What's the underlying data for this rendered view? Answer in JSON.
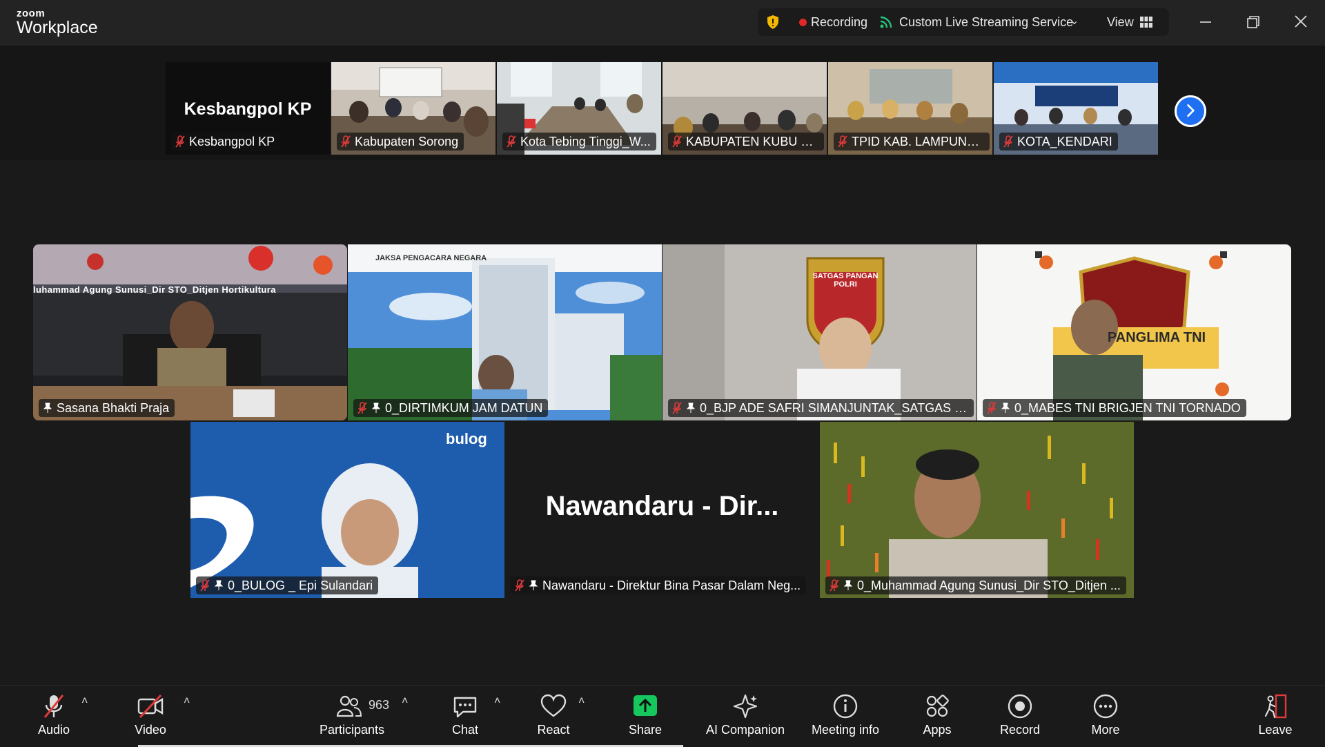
{
  "app": {
    "brand_small": "zoom",
    "brand_big": "Workplace"
  },
  "status_bar": {
    "recording_label": "Recording",
    "streaming_label": "Custom Live Streaming Service",
    "view_label": "View"
  },
  "colors": {
    "accent_blue": "#1e6ff1",
    "active_speaker": "#2fd36d",
    "recording_red": "#e02828",
    "share_green": "#16c75d",
    "muted_red": "#e03a3a"
  },
  "thumbnails": [
    {
      "name": "Kesbangpol KP",
      "card_text": "Kesbangpol KP"
    },
    {
      "name": "Kabupaten Sorong"
    },
    {
      "name": "Kota Tebing Tinggi_W..."
    },
    {
      "name": "KABUPATEN KUBU RA..."
    },
    {
      "name": "TPID KAB. LAMPUNG ..."
    },
    {
      "name": "KOTA_KENDARI"
    }
  ],
  "gallery": [
    {
      "name": "Sasana Bhakti Praja",
      "overlay_text": "luhammad Agung Sunusi_Dir STO_Ditjen Hortikultura",
      "active": true
    },
    {
      "name": "0_DIRTIMKUM JAM DATUN",
      "overlay_text": "JAKSA PENGACARA NEGARA"
    },
    {
      "name": "0_BJP ADE SAFRI SIMANJUNTAK_SATGAS PA...",
      "overlay_text": "SATGAS PANGAN POLRI"
    },
    {
      "name": "0_MABES TNI BRIGJEN TNI TORNADO",
      "overlay_text": "PANGLIMA TNI"
    },
    {
      "name": "0_BULOG _ Epi Sulandari",
      "overlay_text": "bulog"
    },
    {
      "name": "Nawandaru - Direktur Bina Pasar Dalam Neg...",
      "card_text": "Nawandaru  -  Dir..."
    },
    {
      "name": "0_Muhammad Agung Sunusi_Dir STO_Ditjen ..."
    }
  ],
  "toolbar": {
    "audio": "Audio",
    "video": "Video",
    "participants": "Participants",
    "participant_count": "963",
    "chat": "Chat",
    "react": "React",
    "share": "Share",
    "ai_companion": "AI Companion",
    "meeting_info": "Meeting info",
    "apps": "Apps",
    "record": "Record",
    "more": "More",
    "leave": "Leave"
  }
}
